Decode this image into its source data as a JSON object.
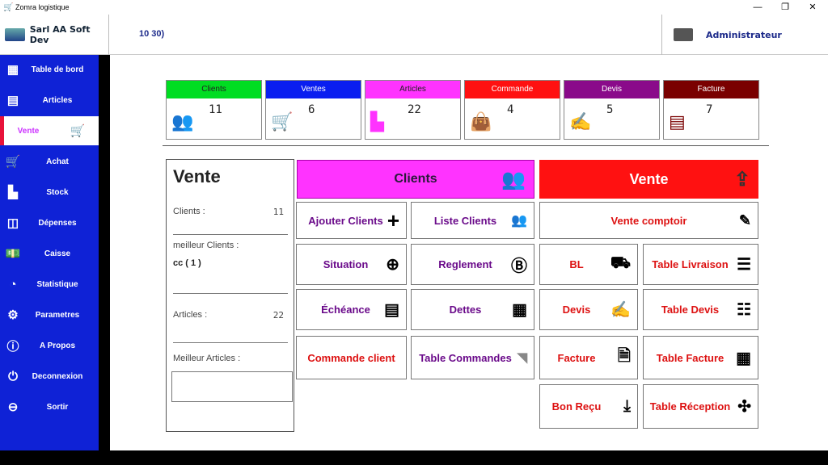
{
  "window": {
    "title": "Zomra logistique",
    "minimize": "—",
    "maximize": "❐",
    "close": "✕"
  },
  "topbar": {
    "company": "Sarl AA Soft Dev",
    "value": "10 30)",
    "user": "Administrateur"
  },
  "sidebar": {
    "items": [
      {
        "label": "Table de bord",
        "icon": "grid-icon"
      },
      {
        "label": "Articles",
        "icon": "document-icon"
      },
      {
        "label": "Vente",
        "icon": "cart-icon",
        "active": true
      },
      {
        "label": "Achat",
        "icon": "cart-icon"
      },
      {
        "label": "Stock",
        "icon": "forklift-icon"
      },
      {
        "label": "Dépenses",
        "icon": "box-icon"
      },
      {
        "label": "Caisse",
        "icon": "money-icon"
      },
      {
        "label": "Statistique",
        "icon": "pie-chart-icon"
      },
      {
        "label": "Parametres",
        "icon": "gear-icon"
      },
      {
        "label": "A Propos",
        "icon": "info-icon"
      },
      {
        "label": "Deconnexion",
        "icon": "power-icon"
      },
      {
        "label": "Sortir",
        "icon": "minus-circle-icon"
      }
    ]
  },
  "cards": [
    {
      "label": "Clients",
      "value": "11",
      "color": "#00dd22",
      "icon": "users-icon"
    },
    {
      "label": "Ventes",
      "value": "6",
      "color": "#0a1ef0",
      "icon": "delivery-icon"
    },
    {
      "label": "Articles",
      "value": "22",
      "color": "#ff33ff",
      "icon": "forklift-icon"
    },
    {
      "label": "Commande",
      "value": "4",
      "color": "#ff1111",
      "icon": "shopping-bag-icon"
    },
    {
      "label": "Devis",
      "value": "5",
      "color": "#8a0a8a",
      "icon": "edit-icon"
    },
    {
      "label": "Facture",
      "value": "7",
      "color": "#7a0000",
      "icon": "receipt-icon"
    }
  ],
  "panel": {
    "title": "Vente",
    "clients_label": "Clients :",
    "clients_value": "11",
    "best_clients_label": "meilleur  Clients :",
    "best_clients_value": "cc ( 1 )",
    "articles_label": "Articles :",
    "articles_value": "22",
    "best_articles_label": "Meilleur Articles :"
  },
  "buttons": {
    "clients_header": "Clients",
    "vente_header": "Vente",
    "ajouter_clients": "Ajouter Clients",
    "liste_clients": "Liste Clients",
    "vente_comptoir": "Vente comptoir",
    "situation": "Situation",
    "reglement": "Reglement",
    "bl": "BL",
    "table_livraison": "Table Livraison",
    "echeance": "Échéance",
    "dettes": "Dettes",
    "devis": "Devis",
    "table_devis": "Table Devis",
    "commande_client": "Commande client",
    "table_commandes": "Table Commandes",
    "facture": "Facture",
    "table_facture": "Table Facture",
    "bon_recu": "Bon Reçu",
    "table_reception": "Table Réception"
  },
  "colors": {
    "sidebar": "#0f22d6",
    "red": "#dd1111",
    "purple": "#6a0a8a",
    "magenta": "#ff33ff",
    "vente_red": "#ff1111"
  }
}
